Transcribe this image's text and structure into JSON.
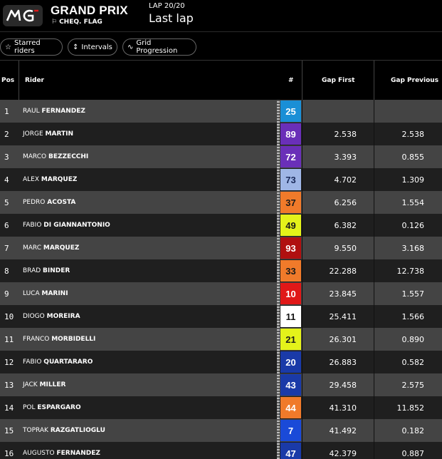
{
  "header": {
    "title": "GRAND PRIX",
    "flag_text": "CHEQ. FLAG",
    "lap": "LAP 20/20",
    "status": "Last lap"
  },
  "toolbar": {
    "starred": "Starred riders",
    "intervals": "Intervals",
    "grid": "Grid Progression"
  },
  "columns": {
    "pos": "Pos",
    "rider": "Rider",
    "number": "#",
    "gap_first": "Gap First",
    "gap_previous": "Gap Previous"
  },
  "rows": [
    {
      "pos": "1",
      "first": "RAUL",
      "last": "FERNANDEZ",
      "num": "25",
      "bg": "#1a8fd6",
      "fg": "#ffffff",
      "gap_first": "",
      "gap_prev": ""
    },
    {
      "pos": "2",
      "first": "JORGE",
      "last": "MARTIN",
      "num": "89",
      "bg": "#6a2fb8",
      "fg": "#ffffff",
      "gap_first": "2.538",
      "gap_prev": "2.538"
    },
    {
      "pos": "3",
      "first": "MARCO",
      "last": "BEZZECCHI",
      "num": "72",
      "bg": "#6a2fb8",
      "fg": "#ffffff",
      "gap_first": "3.393",
      "gap_prev": "0.855"
    },
    {
      "pos": "4",
      "first": "ALEX",
      "last": "MARQUEZ",
      "num": "73",
      "bg": "#9fb6e6",
      "fg": "#1a2a5a",
      "gap_first": "4.702",
      "gap_prev": "1.309"
    },
    {
      "pos": "5",
      "first": "PEDRO",
      "last": "ACOSTA",
      "num": "37",
      "bg": "#f07a2a",
      "fg": "#1a1a1a",
      "gap_first": "6.256",
      "gap_prev": "1.554"
    },
    {
      "pos": "6",
      "first": "FABIO",
      "last": "DI GIANNANTONIO",
      "num": "49",
      "bg": "#e4f21a",
      "fg": "#1a1a1a",
      "gap_first": "6.382",
      "gap_prev": "0.126"
    },
    {
      "pos": "7",
      "first": "MARC",
      "last": "MARQUEZ",
      "num": "93",
      "bg": "#b01010",
      "fg": "#ffffff",
      "gap_first": "9.550",
      "gap_prev": "3.168"
    },
    {
      "pos": "8",
      "first": "BRAD",
      "last": "BINDER",
      "num": "33",
      "bg": "#f07a2a",
      "fg": "#1a1a1a",
      "gap_first": "22.288",
      "gap_prev": "12.738"
    },
    {
      "pos": "9",
      "first": "LUCA",
      "last": "MARINI",
      "num": "10",
      "bg": "#e01818",
      "fg": "#ffffff",
      "gap_first": "23.845",
      "gap_prev": "1.557"
    },
    {
      "pos": "10",
      "first": "DIOGO",
      "last": "MOREIRA",
      "num": "11",
      "bg": "#ffffff",
      "fg": "#111111",
      "gap_first": "25.411",
      "gap_prev": "1.566"
    },
    {
      "pos": "11",
      "first": "FRANCO",
      "last": "MORBIDELLI",
      "num": "21",
      "bg": "#e4f21a",
      "fg": "#1a1a1a",
      "gap_first": "26.301",
      "gap_prev": "0.890"
    },
    {
      "pos": "12",
      "first": "FABIO",
      "last": "QUARTARARO",
      "num": "20",
      "bg": "#1a3aa8",
      "fg": "#ffffff",
      "gap_first": "26.883",
      "gap_prev": "0.582"
    },
    {
      "pos": "13",
      "first": "JACK",
      "last": "MILLER",
      "num": "43",
      "bg": "#1a3aa8",
      "fg": "#ffffff",
      "gap_first": "29.458",
      "gap_prev": "2.575"
    },
    {
      "pos": "14",
      "first": "POL",
      "last": "ESPARGARO",
      "num": "44",
      "bg": "#f07a2a",
      "fg": "#ffffff",
      "gap_first": "41.310",
      "gap_prev": "11.852"
    },
    {
      "pos": "15",
      "first": "TOPRAK",
      "last": "RAZGATLIOGLU",
      "num": "7",
      "bg": "#1a4ad8",
      "fg": "#ffffff",
      "gap_first": "41.492",
      "gap_prev": "0.182"
    },
    {
      "pos": "16",
      "first": "AUGUSTO",
      "last": "FERNANDEZ",
      "num": "47",
      "bg": "#1a3aa8",
      "fg": "#ffffff",
      "gap_first": "42.379",
      "gap_prev": "0.887"
    }
  ]
}
